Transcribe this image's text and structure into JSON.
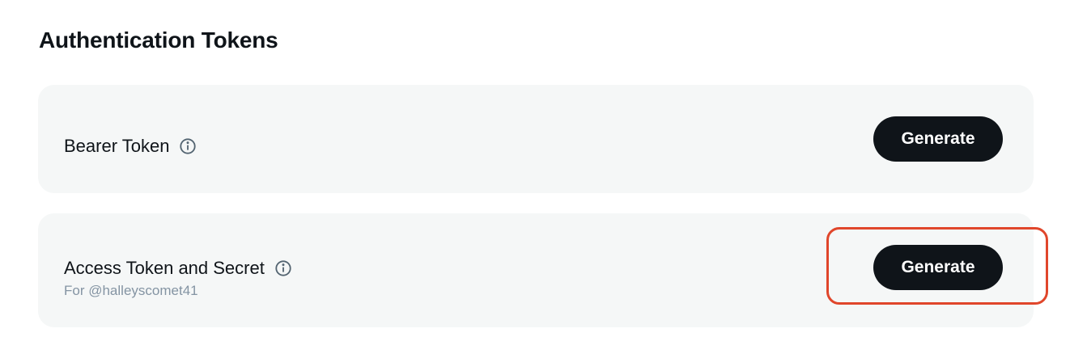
{
  "section": {
    "title": "Authentication Tokens"
  },
  "bearer_token": {
    "label": "Bearer Token",
    "info_icon": "info-circle-icon",
    "button_label": "Generate"
  },
  "access_token": {
    "label": "Access Token and Secret",
    "info_icon": "info-circle-icon",
    "subtitle": "For @halleyscomet41",
    "button_label": "Generate",
    "highlighted": true
  },
  "colors": {
    "button_bg": "#0f1419",
    "card_bg": "#f5f7f7",
    "subtitle": "#8494a3",
    "highlight": "#e0462b"
  }
}
